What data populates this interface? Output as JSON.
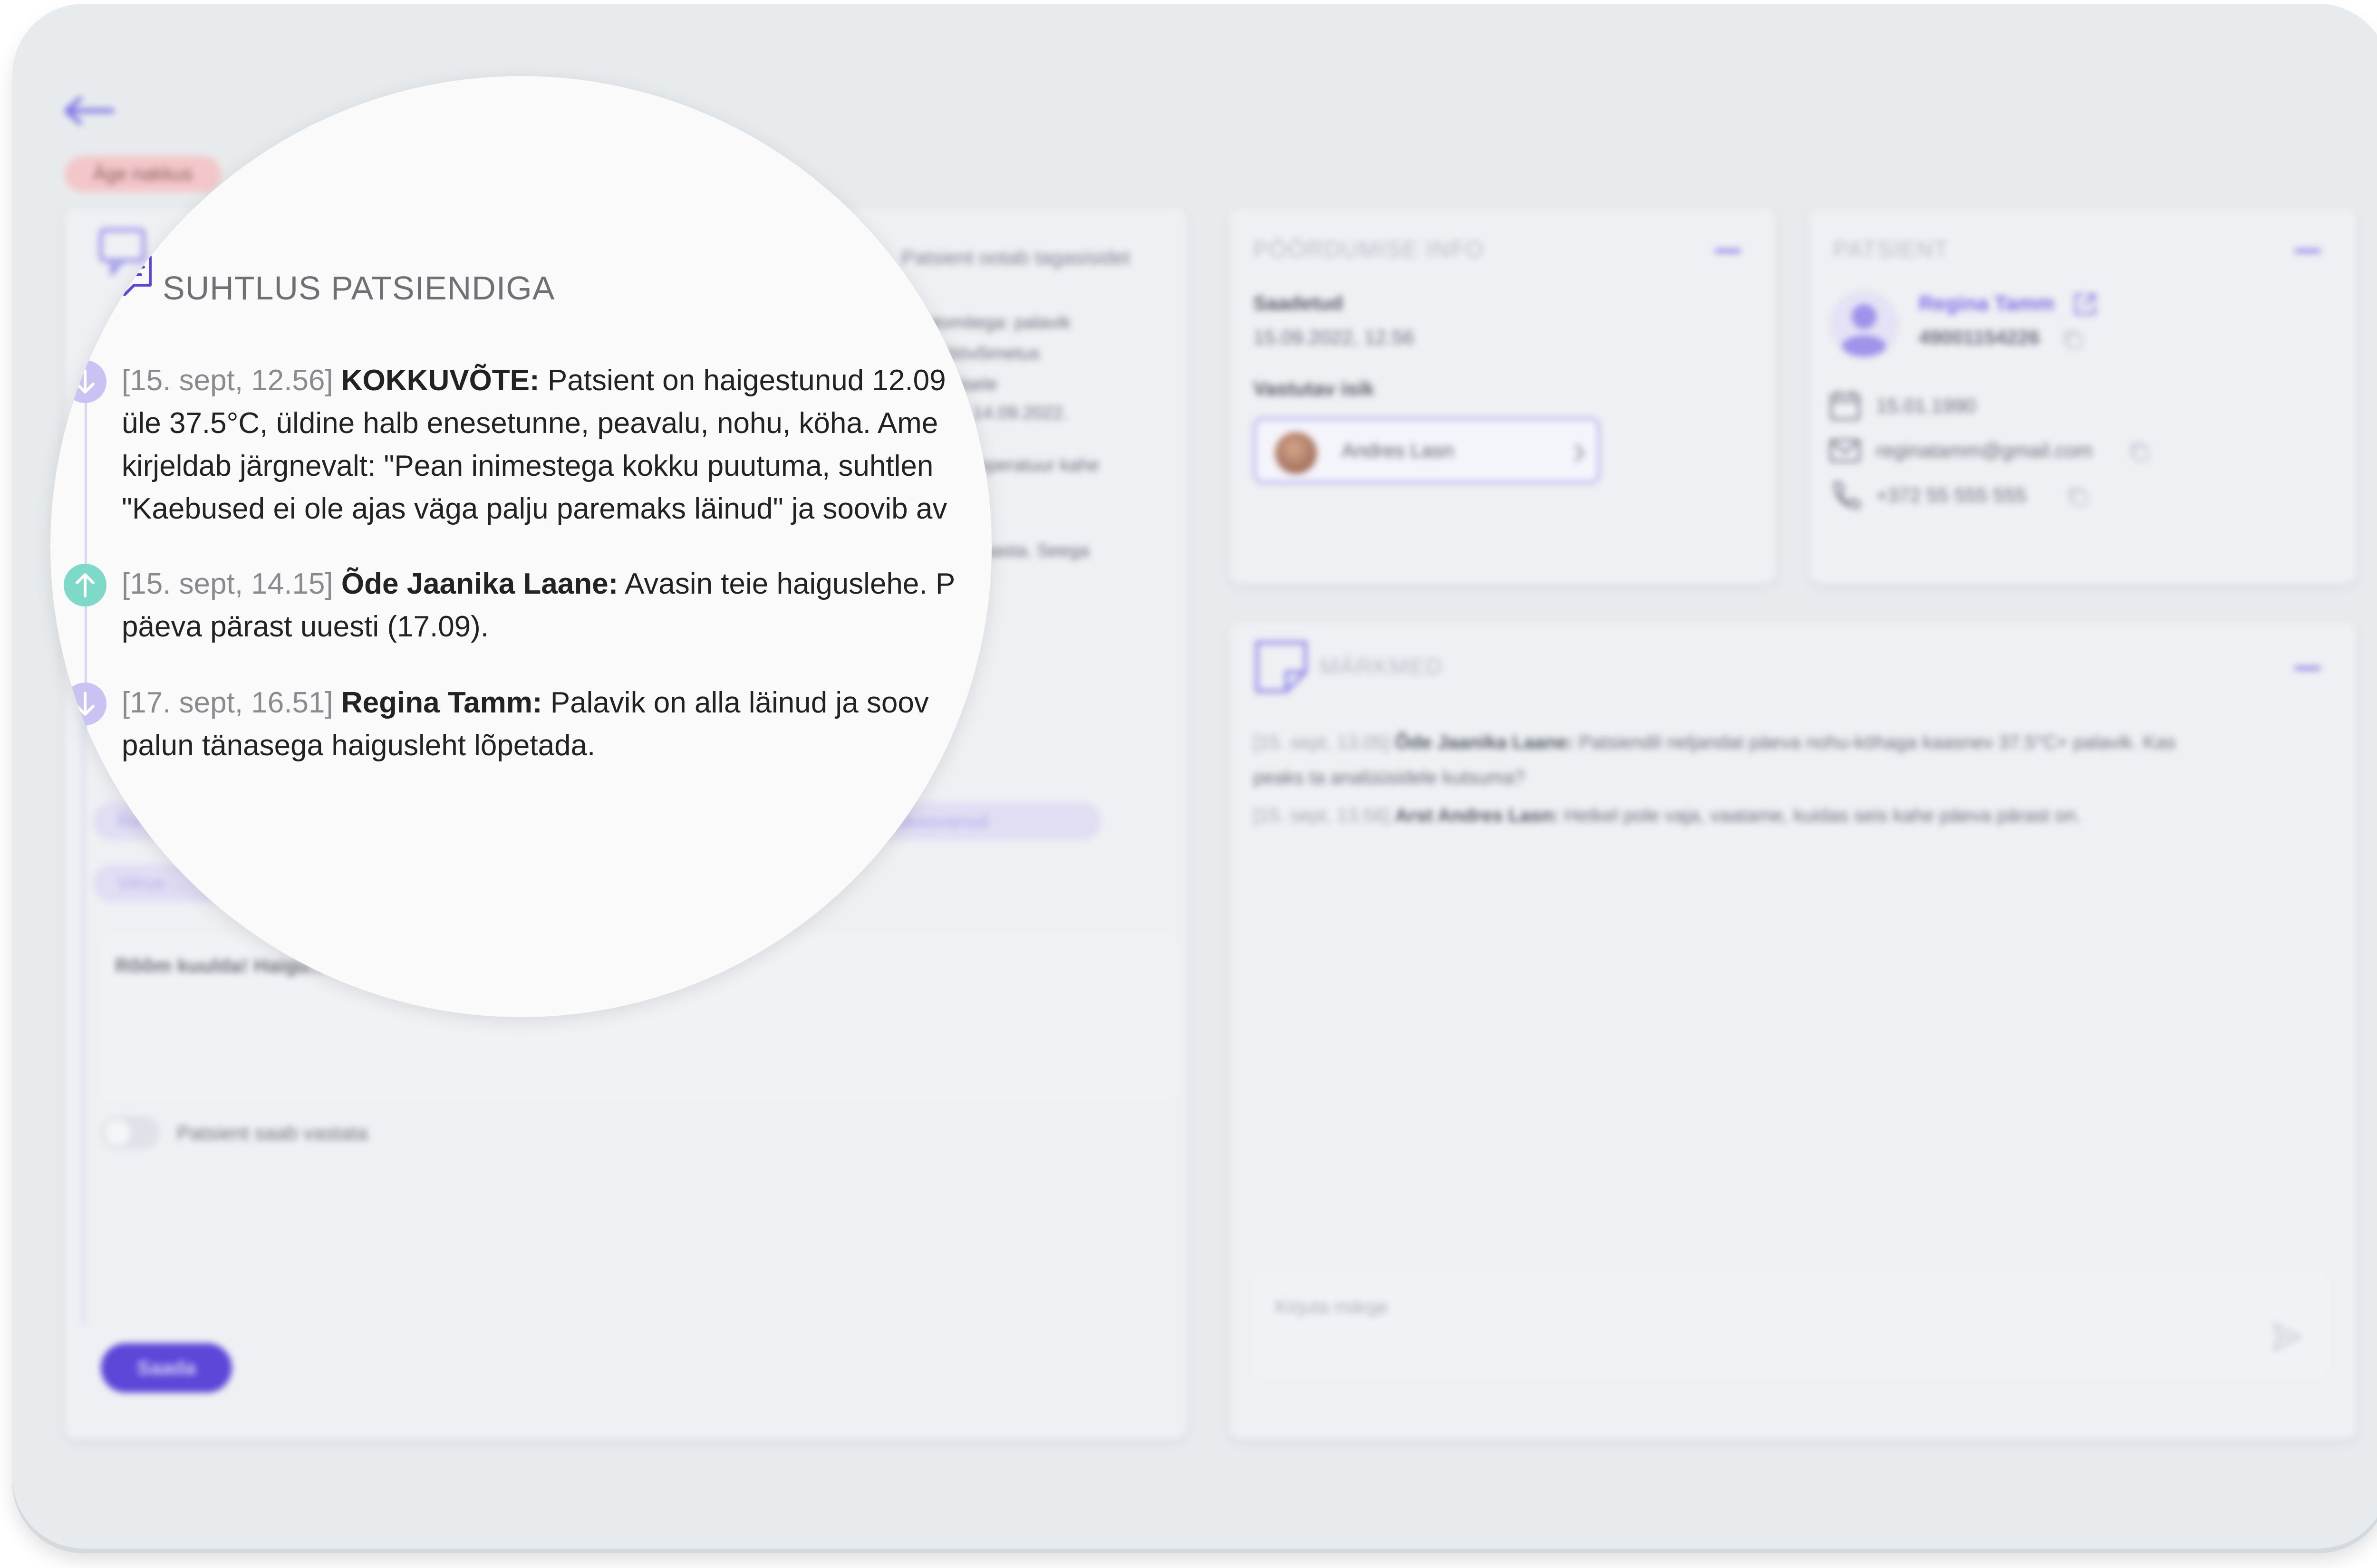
{
  "tag": {
    "label": "Äge nakkus"
  },
  "communication": {
    "title": "SUHTLUS PATSIENDIGA",
    "status": "Patsient ootab tagasisidet",
    "bg_fragments": [
      "ptomitega: palavik",
      "°, töövõimetus",
      "dumisele",
      "14.09.2022.",
      "mperatuur kahe",
      "naasta. Seega"
    ],
    "chips": [
      "Re...",
      "Viirus-...",
      "...iskasvanud"
    ],
    "reply_text": "Rõõm kuulda! Haigu...",
    "toggle_label": "Patsient saab vastata",
    "send_label": "Saada",
    "messages": [
      {
        "timestamp": "[15. sept, 12.56]",
        "author": "KOKKUVÕTE:",
        "lines": [
          "Patsient on haigestunud 12.09",
          "üle 37.5°C, üldine halb enesetunne, peavalu, nohu, köha. Ame",
          "kirjeldab järgnevalt: \"Pean inimestega kokku puutuma, suhtlen",
          "\"Kaebused ei ole ajas väga palju paremaks läinud\" ja soovib av"
        ],
        "direction": "incoming"
      },
      {
        "timestamp": "[15. sept, 14.15]",
        "author": "Õde Jaanika Laane:",
        "lines": [
          "Avasin teie haiguslehe. P",
          "päeva pärast uuesti (17.09)."
        ],
        "direction": "outgoing"
      },
      {
        "timestamp": "[17. sept, 16.51]",
        "author": "Regina Tamm:",
        "lines": [
          "Palavik on alla läinud ja soov",
          "palun tänasega haigusleht lõpetada."
        ],
        "direction": "incoming"
      }
    ]
  },
  "request_info": {
    "title": "PÖÖRDUMISE INFO",
    "sent_label": "Saadetud",
    "sent_value": "15.09.2022, 12.56",
    "responsible_label": "Vastutav isik",
    "responsible_name": "Andres Lasn"
  },
  "patient": {
    "title": "PATSIENT",
    "name": "Regina Tamm",
    "id_code": "49001154226",
    "birthdate": "15.01.1990",
    "email": "reginatamm@gmail.com",
    "phone": "+372 55 555 555"
  },
  "notes": {
    "title": "MÄRKMED",
    "items": [
      {
        "timestamp": "[15. sept, 13.05]",
        "author": "Õde Jaanika Laane:",
        "lines": [
          "Patsiendil neljandat päeva nohu-köhaga kaasnev 37.5°C+ palavik. Kas",
          "peaks ta analüüsidele kutsuma?"
        ]
      },
      {
        "timestamp": "[15. sept, 13.56]",
        "author": "Arst Andres Lasn:",
        "lines": [
          "Hetkel pole vaja, vaatame, kuidas seis kahe päeva pärast on."
        ]
      }
    ],
    "input_placeholder": "Kirjuta märge"
  },
  "colors": {
    "accent": "#5b47d8",
    "incoming_dot": "#c9c2f2",
    "outgoing_dot": "#7fd9c8",
    "tag_bg": "#f3c7c9"
  }
}
